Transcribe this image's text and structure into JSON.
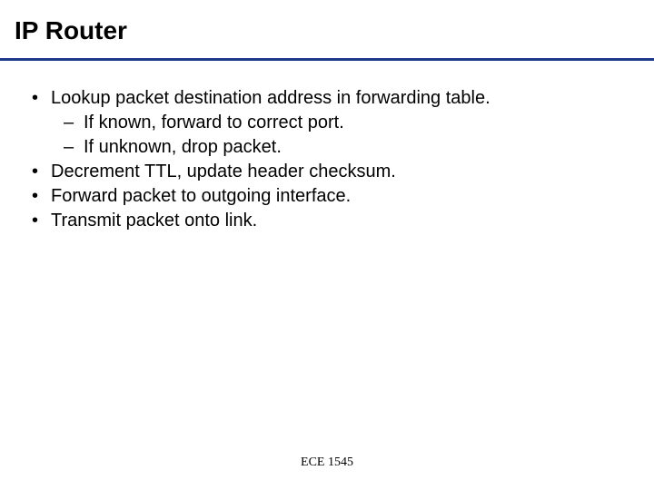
{
  "slide": {
    "title": "IP Router",
    "bullets": [
      {
        "text": "Lookup packet destination address in forwarding table.",
        "sub": [
          "If known, forward to correct port.",
          "If unknown, drop packet."
        ]
      },
      {
        "text": "Decrement TTL, update header checksum.",
        "sub": []
      },
      {
        "text": "Forward packet to outgoing interface.",
        "sub": []
      },
      {
        "text": "Transmit packet onto link.",
        "sub": []
      }
    ],
    "footer": "ECE 1545"
  }
}
